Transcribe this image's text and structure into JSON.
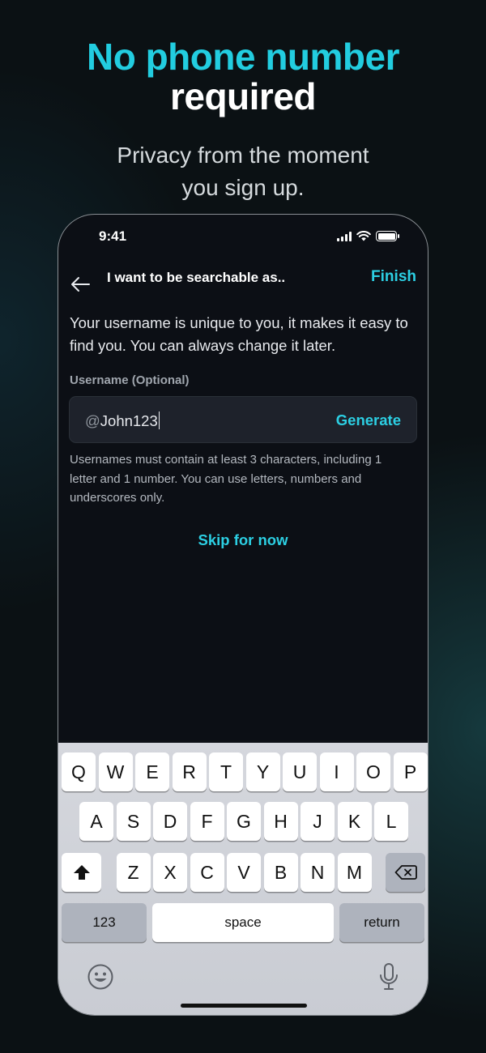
{
  "hero": {
    "title_line1": "No phone number",
    "title_line2": "required",
    "subtitle_line1": "Privacy from the moment",
    "subtitle_line2": "you sign up."
  },
  "status_bar": {
    "time": "9:41"
  },
  "nav": {
    "back_icon": "arrow-left-icon",
    "title": "I want to be searchable as..",
    "finish_label": "Finish"
  },
  "form": {
    "description": "Your username is unique to you, it makes it easy to find you. You can always change it later.",
    "field_label": "Username (Optional)",
    "prefix": "@",
    "username_value": "John123",
    "generate_label": "Generate",
    "hint": "Usernames must contain at least 3 characters, including 1 letter and 1 number. You can use letters, numbers and underscores only.",
    "skip_label": "Skip for now"
  },
  "keyboard": {
    "row1": [
      "Q",
      "W",
      "E",
      "R",
      "T",
      "Y",
      "U",
      "I",
      "O",
      "P"
    ],
    "row2": [
      "A",
      "S",
      "D",
      "F",
      "G",
      "H",
      "J",
      "K",
      "L"
    ],
    "row3": [
      "Z",
      "X",
      "C",
      "V",
      "B",
      "N",
      "M"
    ],
    "numbers_label": "123",
    "space_label": "space",
    "return_label": "return",
    "shift_icon": "shift-icon",
    "delete_icon": "backspace-icon",
    "emoji_icon": "emoji-icon",
    "mic_icon": "microphone-icon"
  },
  "colors": {
    "accent": "#2ccfe3",
    "background": "#0b1114",
    "screen": "#0c0f15"
  }
}
